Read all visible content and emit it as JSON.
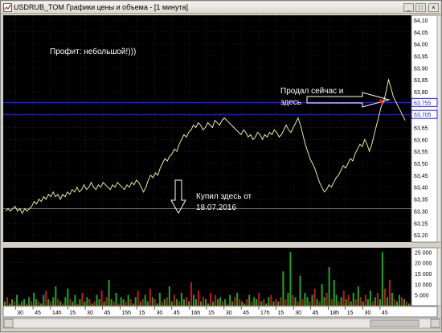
{
  "window": {
    "title": "USDRUB_TOM Графики цены и объема - [1 минута]",
    "buttons": {
      "minimize": "_",
      "maximize": "□",
      "close": "×"
    }
  },
  "annotations": {
    "profit": "Профит:  небольшой!)))",
    "sold_line1": "Продал сейчас и",
    "sold_line2": "здесь",
    "bought_line1": "Купил здесь от",
    "bought_line2": "18.07.2016"
  },
  "colors": {
    "background": "#000000",
    "price_line": "#e8e89a",
    "grid": "#3a3a3a",
    "level_line": "#2b2bd6",
    "buy_level": "#c8c8c8",
    "vol_up": "#1fa01f",
    "vol_down": "#c01818",
    "sell_marker": "#ff2020"
  },
  "chart_data": [
    {
      "type": "line",
      "name": "price",
      "ylim": [
        63.17,
        64.12
      ],
      "yticks": [
        "64,10",
        "64,05",
        "64,00",
        "63,95",
        "63,90",
        "63,85",
        "63,80",
        "63,75",
        "63,70",
        "63,65",
        "63,60",
        "63,55",
        "63,50",
        "63,45",
        "63,40",
        "63,35",
        "63,30",
        "63,25",
        "63,20"
      ],
      "ytick_values": [
        64.1,
        64.05,
        64.0,
        63.95,
        63.9,
        63.85,
        63.8,
        63.75,
        63.7,
        63.65,
        63.6,
        63.55,
        63.5,
        63.45,
        63.4,
        63.35,
        63.3,
        63.25,
        63.2
      ],
      "level_labels": [
        "63,755",
        "63,705"
      ],
      "levels": [
        63.755,
        63.705
      ],
      "buy_level": 63.31,
      "sell_price": 63.76,
      "x": [
        0,
        3,
        6,
        9,
        12,
        15,
        18,
        21,
        24,
        27,
        30,
        33,
        36,
        39,
        42,
        45,
        48,
        51,
        54,
        57,
        60,
        63,
        66,
        69,
        72,
        75,
        78,
        81,
        84,
        87,
        90,
        93,
        96,
        99,
        102,
        105,
        108,
        111,
        114,
        117,
        120,
        123,
        126,
        129,
        132,
        135,
        138,
        141,
        144,
        147,
        150,
        153,
        156,
        159,
        162,
        165,
        168,
        171,
        174,
        177,
        180,
        183,
        186,
        189,
        192,
        195,
        198,
        201,
        204,
        207,
        210,
        213,
        216,
        219,
        222,
        225,
        228,
        231,
        234,
        237,
        240,
        243,
        246,
        249,
        252,
        255,
        258,
        261,
        264,
        267,
        270,
        273,
        276,
        279,
        282,
        285,
        288,
        291,
        294,
        297,
        300,
        303,
        306,
        309,
        312,
        315,
        318,
        321,
        324,
        327,
        330,
        333,
        336,
        339,
        342,
        345,
        348,
        351,
        354,
        357,
        360,
        363,
        366,
        369,
        372,
        375,
        378,
        381,
        384,
        387,
        390,
        393,
        396,
        399,
        402,
        405,
        408,
        411,
        414,
        417,
        420,
        423,
        426,
        429,
        432,
        435,
        438,
        441,
        444,
        447,
        450,
        453,
        456,
        459,
        462,
        465,
        468,
        471,
        474,
        477,
        480,
        483,
        486,
        489,
        492,
        495,
        498,
        501,
        504,
        507,
        510
      ],
      "values": [
        63.3,
        63.31,
        63.3,
        63.31,
        63.32,
        63.3,
        63.31,
        63.29,
        63.31,
        63.3,
        63.31,
        63.32,
        63.34,
        63.33,
        63.35,
        63.34,
        63.36,
        63.35,
        63.37,
        63.36,
        63.38,
        63.36,
        63.37,
        63.35,
        63.37,
        63.36,
        63.38,
        63.37,
        63.39,
        63.38,
        63.4,
        63.38,
        63.39,
        63.41,
        63.39,
        63.4,
        63.42,
        63.4,
        63.39,
        63.41,
        63.4,
        63.42,
        63.41,
        63.4,
        63.39,
        63.41,
        63.4,
        63.42,
        63.41,
        63.4,
        63.39,
        63.41,
        63.4,
        63.42,
        63.41,
        63.43,
        63.42,
        63.4,
        63.38,
        63.4,
        63.43,
        63.45,
        63.44,
        63.46,
        63.45,
        63.48,
        63.5,
        63.52,
        63.51,
        63.53,
        63.54,
        63.56,
        63.55,
        63.58,
        63.6,
        63.62,
        63.61,
        63.63,
        63.64,
        63.66,
        63.65,
        63.67,
        63.66,
        63.64,
        63.65,
        63.67,
        63.66,
        63.65,
        63.68,
        63.67,
        63.66,
        63.68,
        63.69,
        63.68,
        63.67,
        63.66,
        63.65,
        63.64,
        63.63,
        63.62,
        63.64,
        63.63,
        63.61,
        63.62,
        63.6,
        63.61,
        63.63,
        63.62,
        63.6,
        63.62,
        63.61,
        63.63,
        63.62,
        63.64,
        63.63,
        63.61,
        63.62,
        63.64,
        63.66,
        63.64,
        63.63,
        63.65,
        63.67,
        63.69,
        63.66,
        63.62,
        63.58,
        63.55,
        63.52,
        63.5,
        63.48,
        63.45,
        63.42,
        63.4,
        63.38,
        63.39,
        63.41,
        63.4,
        63.42,
        63.44,
        63.45,
        63.47,
        63.49,
        63.48,
        63.5,
        63.52,
        63.51,
        63.54,
        63.56,
        63.58,
        63.57,
        63.6,
        63.58,
        63.55,
        63.58,
        63.62,
        63.66,
        63.7,
        63.74,
        63.76,
        63.8,
        63.85,
        63.82,
        63.78,
        63.76,
        63.74,
        63.72,
        63.7,
        63.68
      ]
    },
    {
      "type": "bar",
      "name": "volume",
      "ylim": [
        0,
        27000
      ],
      "yticks": [
        "25 000",
        "20 000",
        "15 000",
        "10 000",
        "5 000"
      ],
      "ytick_values": [
        25000,
        20000,
        15000,
        10000,
        5000
      ],
      "x_ticks": [
        "30",
        "45",
        "14h",
        "15",
        "30",
        "45",
        "15h",
        "15",
        "30",
        "45",
        "16h",
        "15",
        "30",
        "45",
        "17h",
        "15",
        "30",
        "45",
        "18h",
        "15",
        "30",
        "45"
      ],
      "x_tick_pos": [
        0.03,
        0.073,
        0.116,
        0.158,
        0.201,
        0.243,
        0.286,
        0.328,
        0.371,
        0.413,
        0.456,
        0.498,
        0.541,
        0.583,
        0.626,
        0.668,
        0.711,
        0.753,
        0.796,
        0.838,
        0.881,
        0.923
      ],
      "values": [
        2,
        4,
        1,
        3,
        2,
        5,
        1,
        2,
        3,
        1,
        4,
        2,
        6,
        3,
        2,
        1,
        5,
        7,
        3,
        2,
        4,
        9,
        3,
        2,
        1,
        4,
        8,
        3,
        2,
        5,
        1,
        3,
        6,
        2,
        4,
        3,
        1,
        2,
        5,
        3,
        7,
        2,
        4,
        12,
        3,
        2,
        6,
        1,
        4,
        3,
        2,
        5,
        3,
        1,
        4,
        7,
        2,
        3,
        5,
        2,
        8,
        4,
        3,
        1,
        6,
        2,
        3,
        4,
        9,
        2,
        5,
        3,
        2,
        6,
        3,
        4,
        2,
        11,
        5,
        3,
        7,
        2,
        4,
        3,
        1,
        6,
        2,
        5,
        3,
        4,
        2,
        3,
        1,
        5,
        2,
        4,
        6,
        3,
        2,
        1,
        3,
        5,
        2,
        4,
        3,
        6,
        2,
        3,
        1,
        4,
        5,
        2,
        3,
        2,
        4,
        16,
        3,
        6,
        25,
        5,
        4,
        2,
        14,
        3,
        6,
        4,
        2,
        5,
        8,
        3,
        2,
        10,
        4,
        6,
        18,
        3,
        12,
        5,
        2,
        4,
        7,
        3,
        5,
        2,
        6,
        3,
        9,
        4,
        2,
        5,
        3,
        7,
        2,
        4,
        6,
        3,
        25,
        8,
        4,
        12,
        6,
        3,
        2,
        5,
        4,
        3,
        2,
        1
      ],
      "up": [
        1,
        0,
        1,
        1,
        0,
        1,
        0,
        1,
        1,
        0,
        1,
        0,
        1,
        1,
        0,
        1,
        1,
        0,
        1,
        0,
        1,
        1,
        0,
        1,
        0,
        1,
        1,
        0,
        1,
        1,
        0,
        1,
        0,
        1,
        1,
        0,
        1,
        0,
        1,
        1,
        0,
        1,
        0,
        1,
        1,
        0,
        1,
        0,
        1,
        1,
        0,
        1,
        0,
        1,
        1,
        0,
        1,
        0,
        1,
        1,
        0,
        1,
        0,
        1,
        1,
        0,
        1,
        0,
        1,
        1,
        0,
        1,
        0,
        1,
        1,
        0,
        1,
        0,
        1,
        1,
        0,
        1,
        0,
        1,
        1,
        0,
        1,
        0,
        1,
        1,
        0,
        1,
        0,
        1,
        1,
        0,
        1,
        0,
        1,
        1,
        0,
        1,
        0,
        1,
        1,
        0,
        1,
        0,
        1,
        1,
        0,
        1,
        0,
        1,
        0,
        1,
        0,
        1,
        1,
        0,
        1,
        0,
        1,
        0,
        1,
        1,
        0,
        1,
        0,
        1,
        0,
        1,
        1,
        0,
        1,
        0,
        1,
        1,
        0,
        1,
        0,
        1,
        0,
        1,
        1,
        0,
        1,
        0,
        1,
        0,
        1,
        1,
        0,
        1,
        0,
        1,
        1,
        0,
        1,
        0,
        1,
        0,
        1,
        1,
        0,
        1,
        0,
        1
      ]
    }
  ]
}
